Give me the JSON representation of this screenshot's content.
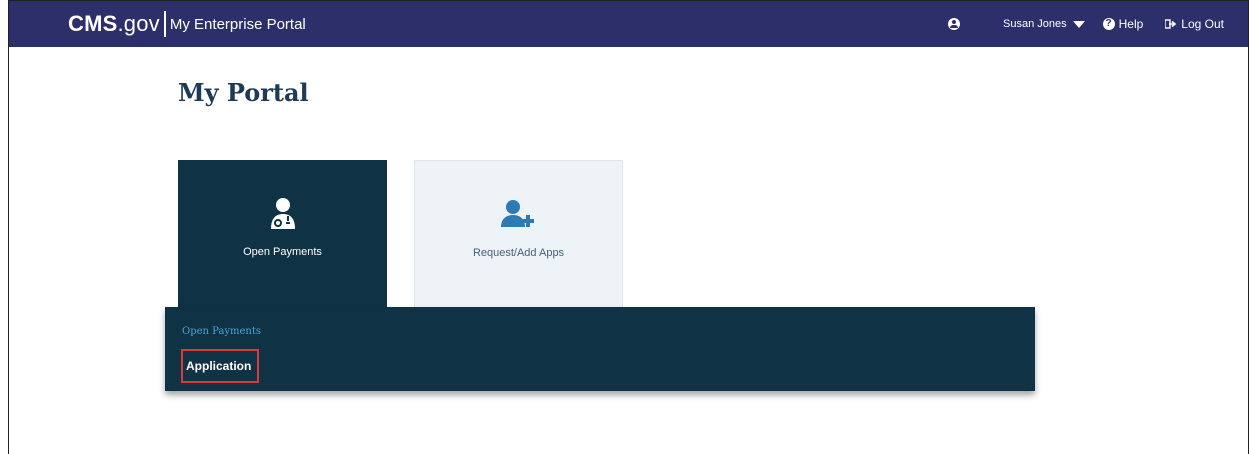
{
  "header": {
    "brand_main": "CMS",
    "brand_dot": ".gov",
    "brand_portal": "My Enterprise Portal",
    "user_name": "Susan Jones",
    "help_label": "Help",
    "logout_label": "Log Out",
    "bar_color": "#2d2f6b"
  },
  "page": {
    "title": "My Portal"
  },
  "tiles": [
    {
      "label": "Open Payments",
      "icon": "doctor-icon",
      "active": true
    },
    {
      "label": "Request/Add Apps",
      "icon": "add-user-icon",
      "active": false
    }
  ],
  "dropdown": {
    "heading": "Open Payments",
    "link": "Application",
    "highlight_color": "#d93a3a"
  }
}
